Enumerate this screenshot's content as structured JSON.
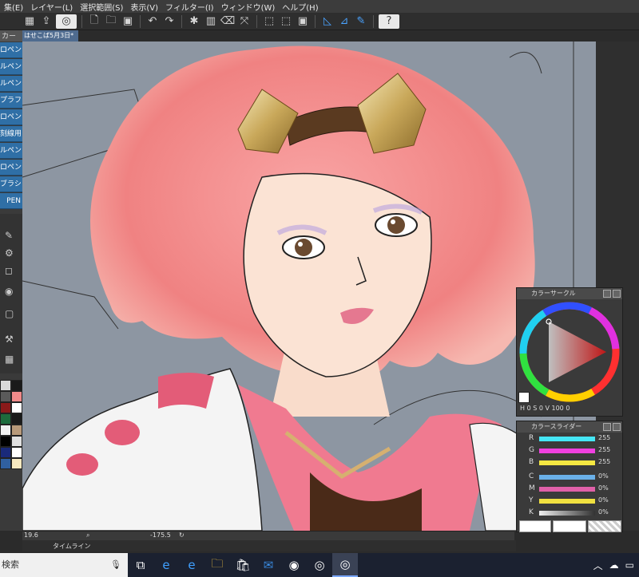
{
  "menu": [
    "集(E)",
    "レイヤー(L)",
    "選択範囲(S)",
    "表示(V)",
    "フィルター(I)",
    "ウィンドウ(W)",
    "ヘルプ(H)"
  ],
  "document_tab": "はせこば5月3日*",
  "left_panel": {
    "header": "カー",
    "brushes": [
      "ロペン",
      "ルペン",
      "ルペン",
      "プラフィ",
      "ロペン",
      "刻線用",
      "ルペン",
      "ロペン",
      "ブラシ",
      "PEN"
    ]
  },
  "color_circle": {
    "title": "カラーサークル",
    "h_value": "0",
    "s_value": "0",
    "v_value": "100",
    "extra_value": "0",
    "h_label": "H",
    "s_label": "S",
    "v_label": "V"
  },
  "color_slider": {
    "title": "カラースライダー",
    "rows": [
      {
        "label": "R",
        "value": "255",
        "color": "#45e6f5"
      },
      {
        "label": "G",
        "value": "255",
        "color": "#f040e0"
      },
      {
        "label": "B",
        "value": "255",
        "color": "#f5e842"
      },
      {
        "label": "C",
        "value": "0%",
        "color": "#6ab0e8"
      },
      {
        "label": "M",
        "value": "0%",
        "color": "#e060a8"
      },
      {
        "label": "Y",
        "value": "0%",
        "color": "#f0e040"
      },
      {
        "label": "K",
        "value": "0%",
        "color": "#aaaaaa"
      }
    ]
  },
  "status": {
    "zoom": "19.6",
    "angle": "-175.5"
  },
  "timeline_label": "タイムライン",
  "taskbar": {
    "search_text": "検索"
  },
  "colors": {
    "accent": "#2f6fa6",
    "canvas_bg": "#8d96a2",
    "hair": "#f28c8c"
  }
}
